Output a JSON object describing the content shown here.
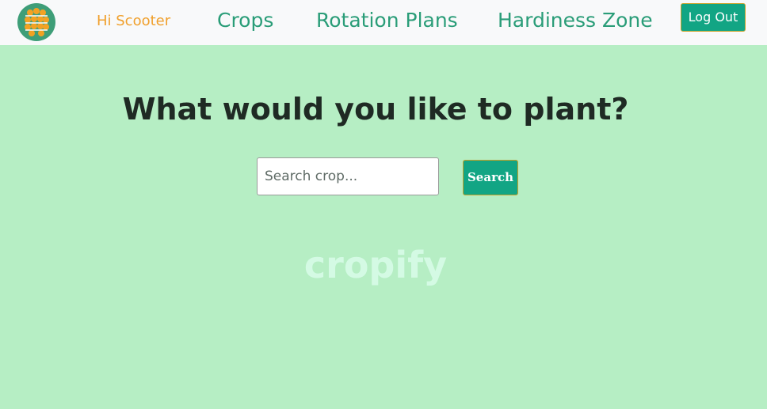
{
  "nav": {
    "logo_icon": "cropify-seed-grid-icon",
    "greeting": "Hi Scooter",
    "links": [
      {
        "label": "Crops"
      },
      {
        "label": "Rotation Plans"
      },
      {
        "label": "Hardiness Zone"
      }
    ],
    "logout_label": "Log Out"
  },
  "main": {
    "headline": "What would you like to plant?",
    "search": {
      "placeholder": "Search crop...",
      "value": "",
      "button_label": "Search"
    },
    "brand": "cropify"
  },
  "colors": {
    "page_background": "#b6eec4",
    "navbar_background": "#f8f9fa",
    "accent_green": "#12a584",
    "nav_link": "#2a9d78",
    "greeting": "#f0a02c",
    "brand_watermark": "#d4fae4"
  }
}
